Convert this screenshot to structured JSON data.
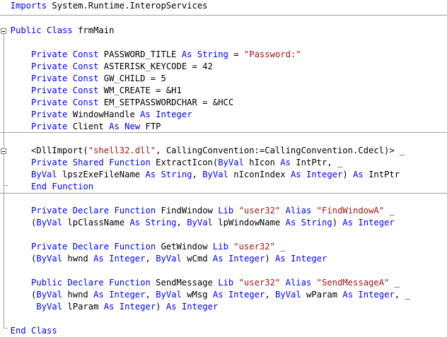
{
  "colors": {
    "keyword": "#0000ff",
    "string": "#a31515",
    "plain": "#000000",
    "background": "#ffffff"
  },
  "icons": {
    "fold_toggle": "collapse-box-icon"
  },
  "code_lines": [
    {
      "indent": 2,
      "tokens": [
        [
          "kw",
          "Imports"
        ],
        [
          "p",
          " System.Runtime.InteropServices"
        ]
      ]
    },
    {
      "indent": 2,
      "tokens": [
        [
          "kw",
          "Public"
        ],
        [
          "p",
          " "
        ],
        [
          "kw",
          "Class"
        ],
        [
          "p",
          " frmMain"
        ]
      ]
    },
    {
      "indent": 6,
      "tokens": [
        [
          "kw",
          "Private"
        ],
        [
          "p",
          " "
        ],
        [
          "kw",
          "Const"
        ],
        [
          "p",
          " PASSWORD_TITLE "
        ],
        [
          "kw",
          "As"
        ],
        [
          "p",
          " "
        ],
        [
          "kw",
          "String"
        ],
        [
          "p",
          " = "
        ],
        [
          "s",
          "\"Password:\""
        ]
      ]
    },
    {
      "indent": 6,
      "tokens": [
        [
          "kw",
          "Private"
        ],
        [
          "p",
          " "
        ],
        [
          "kw",
          "Const"
        ],
        [
          "p",
          " ASTERISK_KEYCODE = 42"
        ]
      ]
    },
    {
      "indent": 6,
      "tokens": [
        [
          "kw",
          "Private"
        ],
        [
          "p",
          " "
        ],
        [
          "kw",
          "Const"
        ],
        [
          "p",
          " GW_CHILD = 5"
        ]
      ]
    },
    {
      "indent": 6,
      "tokens": [
        [
          "kw",
          "Private"
        ],
        [
          "p",
          " "
        ],
        [
          "kw",
          "Const"
        ],
        [
          "p",
          " WM_CREATE = &H1"
        ]
      ]
    },
    {
      "indent": 6,
      "tokens": [
        [
          "kw",
          "Private"
        ],
        [
          "p",
          " "
        ],
        [
          "kw",
          "Const"
        ],
        [
          "p",
          " EM_SETPASSWORDCHAR = &HCC"
        ]
      ]
    },
    {
      "indent": 6,
      "tokens": [
        [
          "kw",
          "Private"
        ],
        [
          "p",
          " WindowHandle "
        ],
        [
          "kw",
          "As"
        ],
        [
          "p",
          " "
        ],
        [
          "kw",
          "Integer"
        ]
      ]
    },
    {
      "indent": 6,
      "tokens": [
        [
          "kw",
          "Private"
        ],
        [
          "p",
          " Client "
        ],
        [
          "kw",
          "As"
        ],
        [
          "p",
          " "
        ],
        [
          "kw",
          "New"
        ],
        [
          "p",
          " FTP"
        ]
      ]
    },
    {
      "indent": 6,
      "tokens": [
        [
          "p",
          "<DllImport("
        ],
        [
          "s",
          "\"shell32.dll\""
        ],
        [
          "p",
          ", CallingConvention:=CallingConvention.Cdecl)> _"
        ]
      ]
    },
    {
      "indent": 6,
      "tokens": [
        [
          "kw",
          "Private"
        ],
        [
          "p",
          " "
        ],
        [
          "kw",
          "Shared"
        ],
        [
          "p",
          " "
        ],
        [
          "kw",
          "Function"
        ],
        [
          "p",
          " ExtractIcon("
        ],
        [
          "kw",
          "ByVal"
        ],
        [
          "p",
          " hIcon "
        ],
        [
          "kw",
          "As"
        ],
        [
          "p",
          " IntPtr, _"
        ]
      ]
    },
    {
      "indent": 6,
      "tokens": [
        [
          "kw",
          "ByVal"
        ],
        [
          "p",
          " lpszExeFileName "
        ],
        [
          "kw",
          "As"
        ],
        [
          "p",
          " "
        ],
        [
          "kw",
          "String"
        ],
        [
          "p",
          ", "
        ],
        [
          "kw",
          "ByVal"
        ],
        [
          "p",
          " nIconIndex "
        ],
        [
          "kw",
          "As"
        ],
        [
          "p",
          " "
        ],
        [
          "kw",
          "Integer"
        ],
        [
          "p",
          ") "
        ],
        [
          "kw",
          "As"
        ],
        [
          "p",
          " IntPtr"
        ]
      ]
    },
    {
      "indent": 6,
      "tokens": [
        [
          "kw",
          "End"
        ],
        [
          "p",
          " "
        ],
        [
          "kw",
          "Function"
        ]
      ]
    },
    {
      "indent": 6,
      "tokens": [
        [
          "kw",
          "Private"
        ],
        [
          "p",
          " "
        ],
        [
          "kw",
          "Declare"
        ],
        [
          "p",
          " "
        ],
        [
          "kw",
          "Function"
        ],
        [
          "p",
          " FindWindow "
        ],
        [
          "kw",
          "Lib"
        ],
        [
          "p",
          " "
        ],
        [
          "s",
          "\"user32\""
        ],
        [
          "p",
          " "
        ],
        [
          "kw",
          "Alias"
        ],
        [
          "p",
          " "
        ],
        [
          "s",
          "\"FindWindowA\""
        ],
        [
          "p",
          " _"
        ]
      ]
    },
    {
      "indent": 6,
      "tokens": [
        [
          "p",
          "("
        ],
        [
          "kw",
          "ByVal"
        ],
        [
          "p",
          " lpClassName "
        ],
        [
          "kw",
          "As"
        ],
        [
          "p",
          " "
        ],
        [
          "kw",
          "String"
        ],
        [
          "p",
          ", "
        ],
        [
          "kw",
          "ByVal"
        ],
        [
          "p",
          " lpWindowName "
        ],
        [
          "kw",
          "As"
        ],
        [
          "p",
          " "
        ],
        [
          "kw",
          "String"
        ],
        [
          "p",
          ") "
        ],
        [
          "kw",
          "As"
        ],
        [
          "p",
          " "
        ],
        [
          "kw",
          "Integer"
        ]
      ]
    },
    {
      "indent": 6,
      "tokens": [
        [
          "kw",
          "Private"
        ],
        [
          "p",
          " "
        ],
        [
          "kw",
          "Declare"
        ],
        [
          "p",
          " "
        ],
        [
          "kw",
          "Function"
        ],
        [
          "p",
          " GetWindow "
        ],
        [
          "kw",
          "Lib"
        ],
        [
          "p",
          " "
        ],
        [
          "s",
          "\"user32\""
        ],
        [
          "p",
          " _"
        ]
      ]
    },
    {
      "indent": 6,
      "tokens": [
        [
          "p",
          "("
        ],
        [
          "kw",
          "ByVal"
        ],
        [
          "p",
          " hwnd "
        ],
        [
          "kw",
          "As"
        ],
        [
          "p",
          " "
        ],
        [
          "kw",
          "Integer"
        ],
        [
          "p",
          ", "
        ],
        [
          "kw",
          "ByVal"
        ],
        [
          "p",
          " wCmd "
        ],
        [
          "kw",
          "As"
        ],
        [
          "p",
          " "
        ],
        [
          "kw",
          "Integer"
        ],
        [
          "p",
          ") "
        ],
        [
          "kw",
          "As"
        ],
        [
          "p",
          " "
        ],
        [
          "kw",
          "Integer"
        ]
      ]
    },
    {
      "indent": 6,
      "tokens": [
        [
          "kw",
          "Public"
        ],
        [
          "p",
          " "
        ],
        [
          "kw",
          "Declare"
        ],
        [
          "p",
          " "
        ],
        [
          "kw",
          "Function"
        ],
        [
          "p",
          " SendMessage "
        ],
        [
          "kw",
          "Lib"
        ],
        [
          "p",
          " "
        ],
        [
          "s",
          "\"user32\""
        ],
        [
          "p",
          " "
        ],
        [
          "kw",
          "Alias"
        ],
        [
          "p",
          " "
        ],
        [
          "s",
          "\"SendMessageA\""
        ],
        [
          "p",
          " _"
        ]
      ]
    },
    {
      "indent": 6,
      "tokens": [
        [
          "p",
          "("
        ],
        [
          "kw",
          "ByVal"
        ],
        [
          "p",
          " hwnd "
        ],
        [
          "kw",
          "As"
        ],
        [
          "p",
          " "
        ],
        [
          "kw",
          "Integer"
        ],
        [
          "p",
          ", "
        ],
        [
          "kw",
          "ByVal"
        ],
        [
          "p",
          " wMsg "
        ],
        [
          "kw",
          "As"
        ],
        [
          "p",
          " "
        ],
        [
          "kw",
          "Integer"
        ],
        [
          "p",
          ", "
        ],
        [
          "kw",
          "ByVal"
        ],
        [
          "p",
          " wParam "
        ],
        [
          "kw",
          "As"
        ],
        [
          "p",
          " "
        ],
        [
          "kw",
          "Integer"
        ],
        [
          "p",
          ", _"
        ]
      ]
    },
    {
      "indent": 7,
      "tokens": [
        [
          "kw",
          "ByVal"
        ],
        [
          "p",
          " lParam "
        ],
        [
          "kw",
          "As"
        ],
        [
          "p",
          " "
        ],
        [
          "kw",
          "Integer"
        ],
        [
          "p",
          ") "
        ],
        [
          "kw",
          "As"
        ],
        [
          "p",
          " "
        ],
        [
          "kw",
          "Integer"
        ]
      ]
    },
    {
      "indent": 2,
      "tokens": [
        [
          "kw",
          "End"
        ],
        [
          "p",
          " "
        ],
        [
          "kw",
          "Class"
        ]
      ]
    }
  ]
}
